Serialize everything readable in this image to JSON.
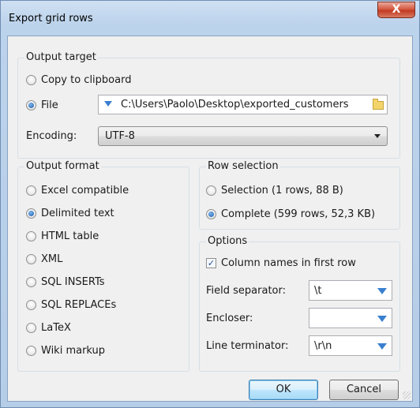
{
  "window": {
    "title": "Export grid rows",
    "close_label": "X"
  },
  "output_target": {
    "title": "Output target",
    "options": [
      "Copy to clipboard",
      "File"
    ],
    "selected": "File",
    "file_path": "C:\\Users\\Paolo\\Desktop\\exported_customers",
    "encoding_label": "Encoding:",
    "encoding_value": "UTF-8"
  },
  "output_format": {
    "title": "Output format",
    "options": [
      "Excel compatible",
      "Delimited text",
      "HTML table",
      "XML",
      "SQL INSERTs",
      "SQL REPLACEs",
      "LaTeX",
      "Wiki markup"
    ],
    "selected": "Delimited text"
  },
  "row_selection": {
    "title": "Row selection",
    "options": [
      "Selection (1 rows, 88 B)",
      "Complete (599 rows, 52,3 KB)"
    ],
    "selected": "Complete (599 rows, 52,3 KB)"
  },
  "options": {
    "title": "Options",
    "column_names_label": "Column names in first row",
    "column_names_checked": true,
    "field_separator_label": "Field separator:",
    "field_separator_value": "\\t",
    "encloser_label": "Encloser:",
    "encloser_value": "",
    "line_terminator_label": "Line terminator:",
    "line_terminator_value": "\\r\\n"
  },
  "buttons": {
    "ok": "OK",
    "cancel": "Cancel"
  },
  "icons": {
    "close": "close-icon",
    "folder": "folder-icon",
    "dropdown": "chevron-down-icon",
    "check": "checkmark-icon"
  }
}
